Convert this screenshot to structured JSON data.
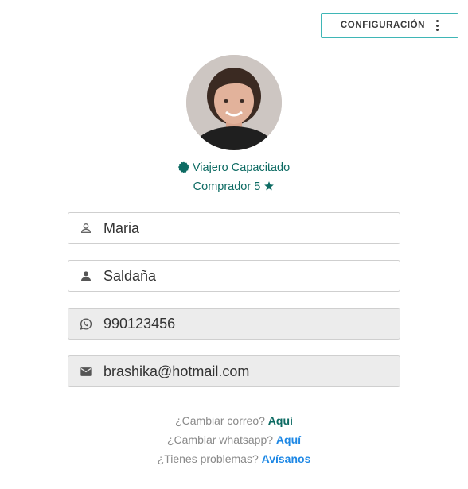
{
  "header": {
    "config_label": "CONFIGURACIÓN"
  },
  "profile": {
    "badge_label": "Viajero Capacitado",
    "buyer_label": "Comprador 5"
  },
  "fields": {
    "first_name": "Maria",
    "last_name": "Saldaña",
    "whatsapp": "990123456",
    "email": "brashika@hotmail.com"
  },
  "links": {
    "change_email_text": "¿Cambiar correo?",
    "change_email_link": "Aquí",
    "change_whatsapp_text": "¿Cambiar whatsapp?",
    "change_whatsapp_link": "Aquí",
    "problems_text": "¿Tienes problemas?",
    "problems_link": "Avísanos"
  },
  "colors": {
    "teal": "#0d6b63",
    "blue": "#1e88e5",
    "border": "#3fb6b6"
  }
}
